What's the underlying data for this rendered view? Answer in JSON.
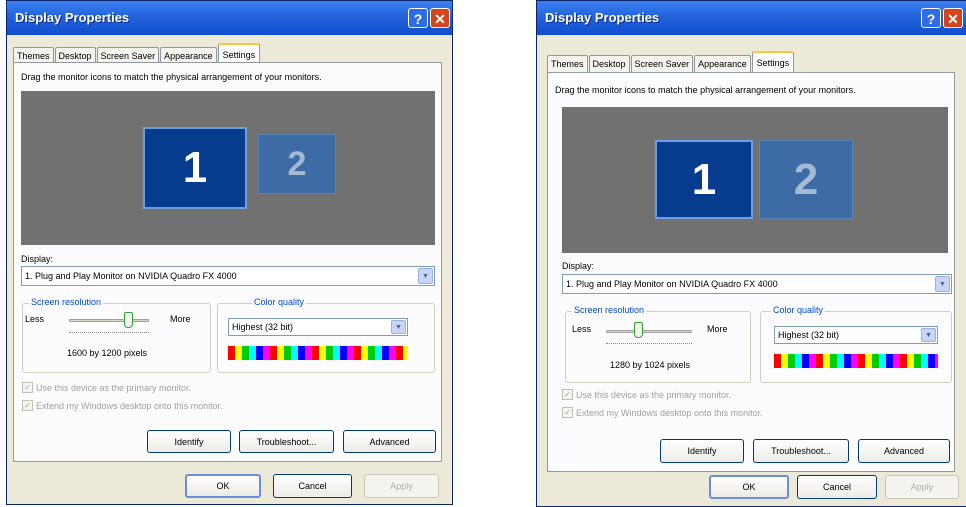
{
  "windows": [
    {
      "title": "Display Properties",
      "tabs": [
        "Themes",
        "Desktop",
        "Screen Saver",
        "Appearance",
        "Settings"
      ],
      "active_tab": "Settings",
      "description": "Drag the monitor icons to match the physical arrangement of your monitors.",
      "monitor_1": "1",
      "monitor_2": "2",
      "display_label": "Display:",
      "display_value": "1. Plug and Play Monitor on NVIDIA Quadro FX 4000",
      "resolution_group": "Screen resolution",
      "less_label": "Less",
      "more_label": "More",
      "resolution_value": "1600 by 1200 pixels",
      "color_group": "Color quality",
      "color_value": "Highest (32 bit)",
      "check_primary": "Use this device as the primary monitor.",
      "check_extend": "Extend my Windows desktop onto this monitor.",
      "identify_label": "Identify",
      "troubleshoot_label": "Troubleshoot...",
      "advanced_label": "Advanced",
      "ok_label": "OK",
      "cancel_label": "Cancel",
      "apply_label": "Apply"
    },
    {
      "title": "Display Properties",
      "tabs": [
        "Themes",
        "Desktop",
        "Screen Saver",
        "Appearance",
        "Settings"
      ],
      "active_tab": "Settings",
      "description": "Drag the monitor icons to match the physical arrangement of your monitors.",
      "monitor_1": "1",
      "monitor_2": "2",
      "display_label": "Display:",
      "display_value": "1. Plug and Play Monitor on NVIDIA Quadro FX 4000",
      "resolution_group": "Screen resolution",
      "less_label": "Less",
      "more_label": "More",
      "resolution_value": "1280 by 1024 pixels",
      "color_group": "Color quality",
      "color_value": "Highest (32 bit)",
      "check_primary": "Use this device as the primary monitor.",
      "check_extend": "Extend my Windows desktop onto this monitor.",
      "identify_label": "Identify",
      "troubleshoot_label": "Troubleshoot...",
      "advanced_label": "Advanced",
      "ok_label": "OK",
      "cancel_label": "Cancel",
      "apply_label": "Apply"
    }
  ],
  "icons": {
    "help": "?",
    "close": "✕",
    "dropdown": "▼",
    "check": "✓"
  },
  "colors": {
    "titlebar": "#2463DA",
    "dialog_bg": "#ECE9D8",
    "monitor_area": "#717171",
    "monitor_primary": "#063B8E",
    "monitor_secondary": "#3C6BA5",
    "group_title": "#0046D5"
  }
}
